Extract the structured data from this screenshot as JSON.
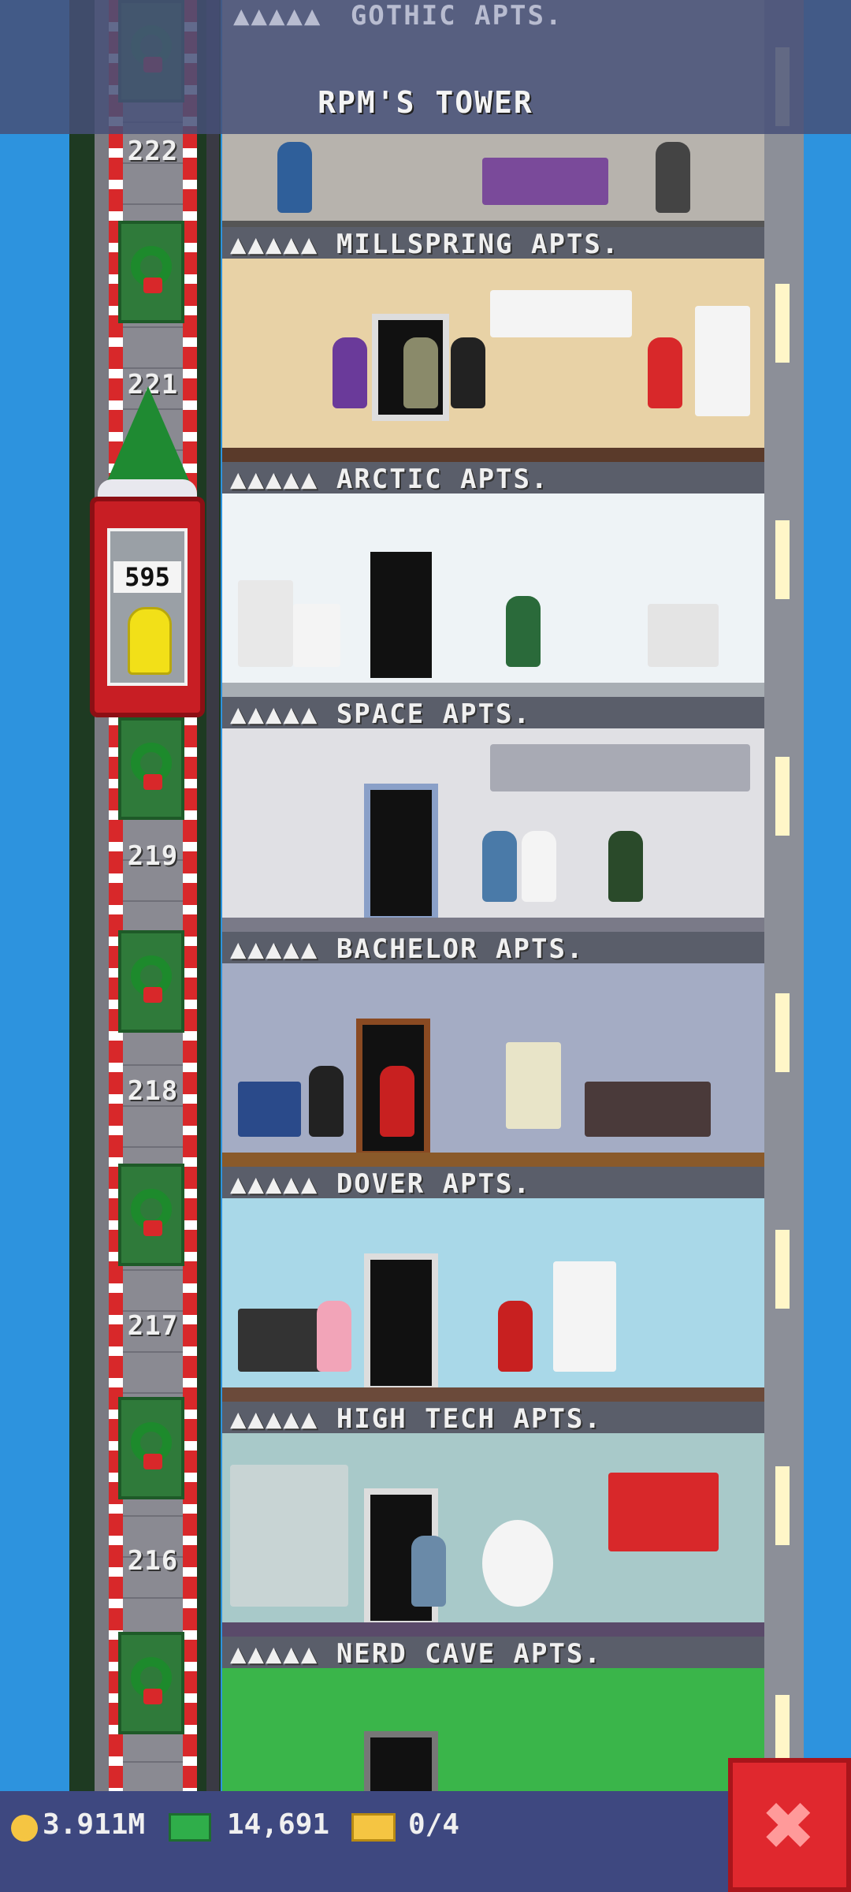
{
  "header": {
    "title": "RPM'S TOWER",
    "partial_floor_label": "GOTHIC APTS."
  },
  "elevator": {
    "floor_numbers": [
      "222",
      "221",
      "219",
      "218",
      "217",
      "216"
    ],
    "passenger_count": "595",
    "decoration_icons": [
      "wreath-icon",
      "christmas-tree-icon"
    ]
  },
  "floors": [
    {
      "name": "MILLSPRING APTS.",
      "room_color": "#e8d2a6"
    },
    {
      "name": "ARCTIC APTS.",
      "room_color": "#eef3f6"
    },
    {
      "name": "SPACE APTS.",
      "room_color": "#e0e0e4"
    },
    {
      "name": "BACHELOR APTS.",
      "room_color": "#a4acc4"
    },
    {
      "name": "DOVER APTS.",
      "room_color": "#a9d8e8"
    },
    {
      "name": "HIGH TECH APTS.",
      "room_color": "#a8c9c9"
    },
    {
      "name": "NERD CAVE APTS.",
      "room_color": "#3ab54a"
    }
  ],
  "bottom_bar": {
    "coins": "3.911M",
    "bux": "14,691",
    "tickets": "0/4",
    "close_icon": "close-x-icon"
  },
  "colors": {
    "sky": "#2d93de",
    "elevator_car": "#c81e24",
    "bottom_bar": "#3e4880",
    "close_button": "#e0282e"
  }
}
